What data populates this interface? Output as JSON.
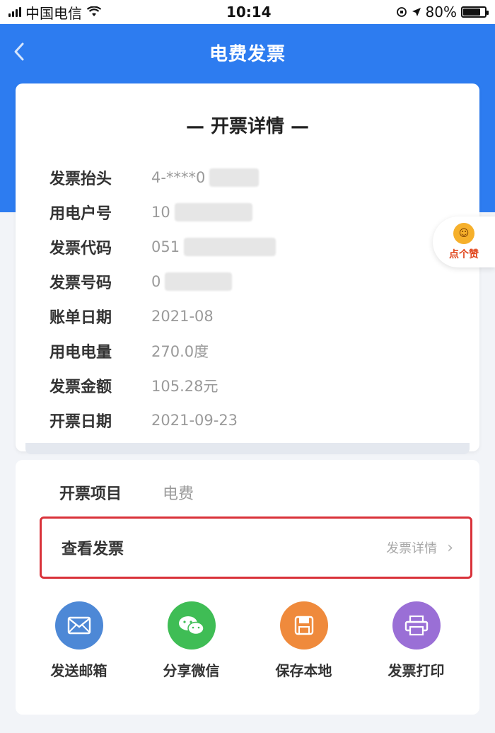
{
  "status_bar": {
    "carrier": "中国电信",
    "time": "10:14",
    "battery": "80%",
    "battery_level": 0.8
  },
  "nav": {
    "title": "电费发票",
    "back_icon": "chevron-left-icon"
  },
  "detail_card": {
    "title": "— 开票详情 —",
    "rows": [
      {
        "label": "发票抬头",
        "value": "4-****0"
      },
      {
        "label": "用电户号",
        "value": "10"
      },
      {
        "label": "发票代码",
        "value": "051"
      },
      {
        "label": "发票号码",
        "value": "0"
      },
      {
        "label": "账单日期",
        "value": "2021-08"
      },
      {
        "label": "用电电量",
        "value": "270.0度"
      },
      {
        "label": "发票金额",
        "value": "105.28元"
      },
      {
        "label": "开票日期",
        "value": "2021-09-23"
      }
    ]
  },
  "panel": {
    "item_label": "开票项目",
    "item_value": "电费",
    "view_invoice_label": "查看发票",
    "view_invoice_link": "发票详情",
    "highlight_color": "#d9323a"
  },
  "actions": [
    {
      "label": "发送邮箱",
      "icon": "mail-icon",
      "color": "#4d88d6"
    },
    {
      "label": "分享微信",
      "icon": "wechat-icon",
      "color": "#3fbd55"
    },
    {
      "label": "保存本地",
      "icon": "save-local-icon",
      "color": "#ef8a3c"
    },
    {
      "label": "发票打印",
      "icon": "printer-icon",
      "color": "#9a6fd6"
    }
  ],
  "helper": {
    "label": "点个赞",
    "icon": "smiley-icon"
  },
  "colors": {
    "brand_blue": "#2d7cf0"
  }
}
